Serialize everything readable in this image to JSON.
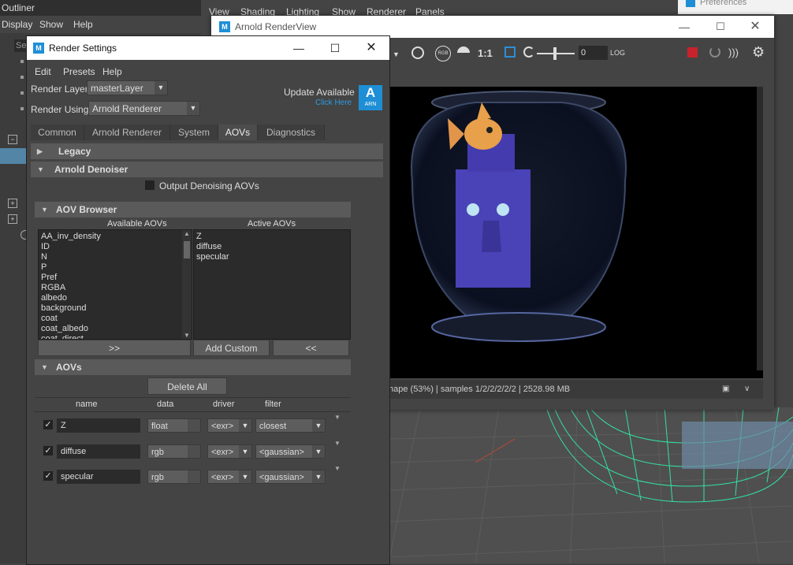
{
  "outliner": {
    "title": "Outliner",
    "menu": [
      "Display",
      "Show",
      "Help"
    ],
    "search_placeholder": "Se"
  },
  "main_menu": [
    "View",
    "Shading",
    "Lighting",
    "Show",
    "Renderer",
    "Panels"
  ],
  "preferences": {
    "title": "Preferences"
  },
  "render_view": {
    "title": "Arnold RenderView",
    "toolbar": {
      "ratio": "1:1",
      "exposure": "0",
      "rgb_label": "RGB",
      "log_label": "LOG"
    },
    "status": "hape (53%) | samples 1/2/2/2/2/2 | 2528.98 MB"
  },
  "render_settings": {
    "title": "Render Settings",
    "menu": [
      "Edit",
      "Presets",
      "Help"
    ],
    "render_layer_label": "Render Layer",
    "render_layer_value": "masterLayer",
    "render_using_label": "Render Using",
    "render_using_value": "Arnold Renderer",
    "update_available": "Update Available",
    "click_here": "Click Here",
    "arn_logo": {
      "letter": "A",
      "text": "ARN"
    },
    "tabs": [
      "Common",
      "Arnold Renderer",
      "System",
      "AOVs",
      "Diagnostics"
    ],
    "sections": {
      "legacy": "Legacy",
      "denoiser": "Arnold Denoiser",
      "browser": "AOV Browser",
      "aovs": "AOVs"
    },
    "output_denoising": "Output Denoising AOVs",
    "available_header": "Available AOVs",
    "active_header": "Active AOVs",
    "available": [
      "AA_inv_density",
      "ID",
      "N",
      "P",
      "Pref",
      "RGBA",
      "albedo",
      "background",
      "coat",
      "coat_albedo",
      "coat_direct"
    ],
    "active": [
      "Z",
      "diffuse",
      "specular"
    ],
    "add_btn": ">>",
    "add_custom": "Add Custom",
    "remove_btn": "<<",
    "delete_all": "Delete All",
    "columns": {
      "name": "name",
      "data": "data",
      "driver": "driver",
      "filter": "filter"
    },
    "rows": [
      {
        "name": "Z",
        "data": "float",
        "driver": "<exr>",
        "filter": "closest"
      },
      {
        "name": "diffuse",
        "data": "rgb",
        "driver": "<exr>",
        "filter": "<gaussian>"
      },
      {
        "name": "specular",
        "data": "rgb",
        "driver": "<exr>",
        "filter": "<gaussian>"
      }
    ]
  },
  "colors": {
    "accent": "#1e8fd6",
    "render_bg": "#000000",
    "fish": "#e8a04a",
    "tiki": "#4a43b8",
    "wire": "#33e0a0"
  }
}
